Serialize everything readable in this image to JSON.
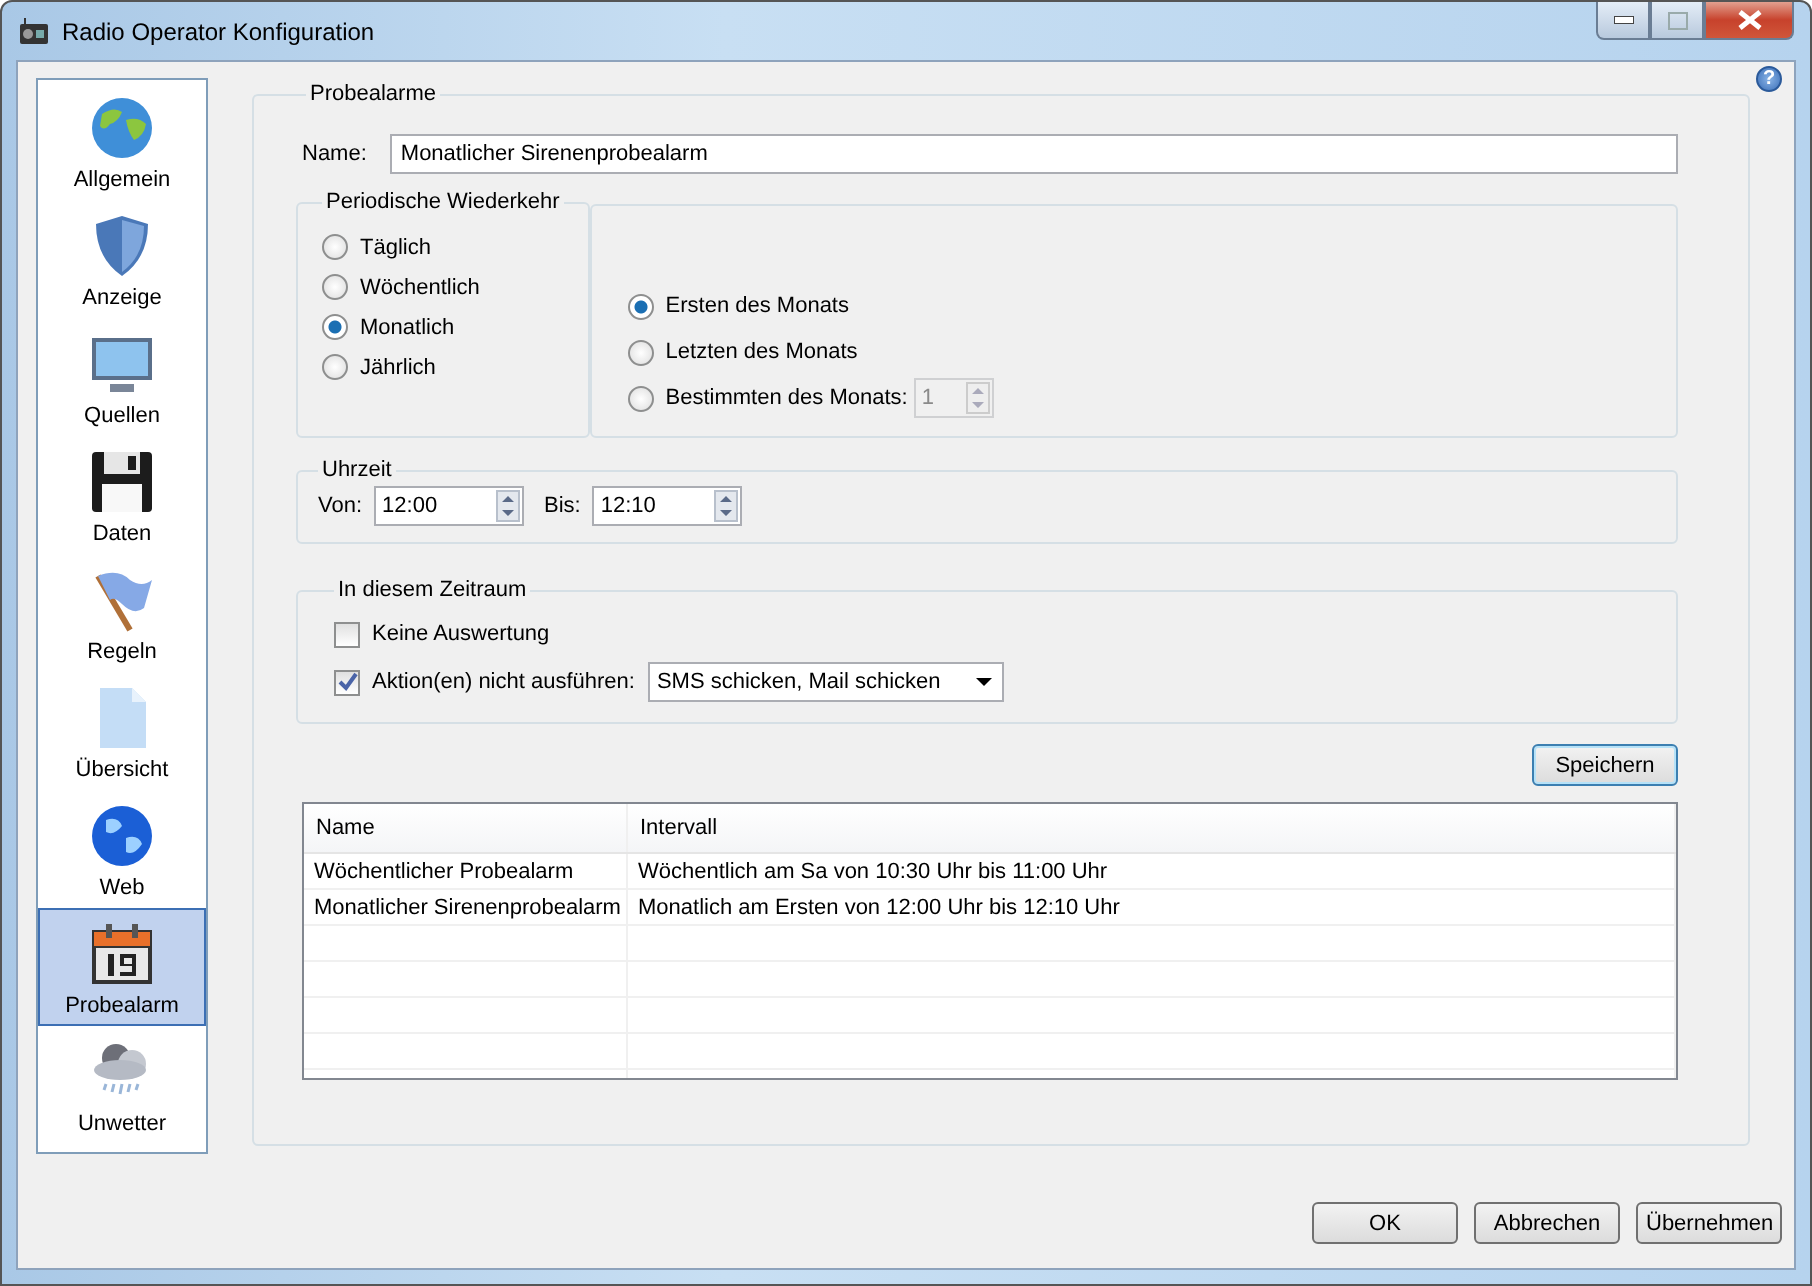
{
  "window": {
    "title": "Radio Operator Konfiguration"
  },
  "help_button": "?",
  "sidebar": {
    "items": [
      {
        "label": "Allgemein",
        "selected": false
      },
      {
        "label": "Anzeige",
        "selected": false
      },
      {
        "label": "Quellen",
        "selected": false
      },
      {
        "label": "Daten",
        "selected": false
      },
      {
        "label": "Regeln",
        "selected": false
      },
      {
        "label": "Übersicht",
        "selected": false
      },
      {
        "label": "Web",
        "selected": false
      },
      {
        "label": "Probealarm",
        "selected": true
      },
      {
        "label": "Unwetter",
        "selected": false
      }
    ]
  },
  "group": {
    "title": "Probealarme"
  },
  "name": {
    "label": "Name:",
    "value": "Monatlicher Sirenenprobealarm"
  },
  "recurrence": {
    "title": "Periodische Wiederkehr",
    "options": [
      {
        "label": "Täglich",
        "selected": false
      },
      {
        "label": "Wöchentlich",
        "selected": false
      },
      {
        "label": "Monatlich",
        "selected": true
      },
      {
        "label": "Jährlich",
        "selected": false
      }
    ]
  },
  "monthly_options": [
    {
      "label": "Ersten des Monats",
      "selected": true
    },
    {
      "label": "Letzten des Monats",
      "selected": false
    },
    {
      "label": "Bestimmten des Monats:",
      "selected": false
    }
  ],
  "day_spinner": {
    "value": "1",
    "disabled": true
  },
  "time": {
    "title": "Uhrzeit",
    "from_label": "Von:",
    "from": "12:00",
    "to_label": "Bis:",
    "to": "12:10"
  },
  "period": {
    "title": "In diesem Zeitraum",
    "options": [
      {
        "label": "Keine Auswertung",
        "checked": false
      },
      {
        "label": "Aktion(en) nicht ausführen:",
        "checked": true
      }
    ],
    "actions_dropdown": "SMS schicken, Mail schicken"
  },
  "save_button": "Speichern",
  "table": {
    "columns": [
      "Name",
      "Intervall"
    ],
    "rows": [
      [
        "Wöchentlicher Probealarm",
        "Wöchentlich am Sa von 10:30 Uhr bis 11:00 Uhr"
      ],
      [
        "Monatlicher Sirenenprobealarm",
        "Monatlich am Ersten von 12:00 Uhr bis 12:10 Uhr"
      ]
    ]
  },
  "buttons": [
    "OK",
    "Abbrechen",
    "Übernehmen"
  ]
}
